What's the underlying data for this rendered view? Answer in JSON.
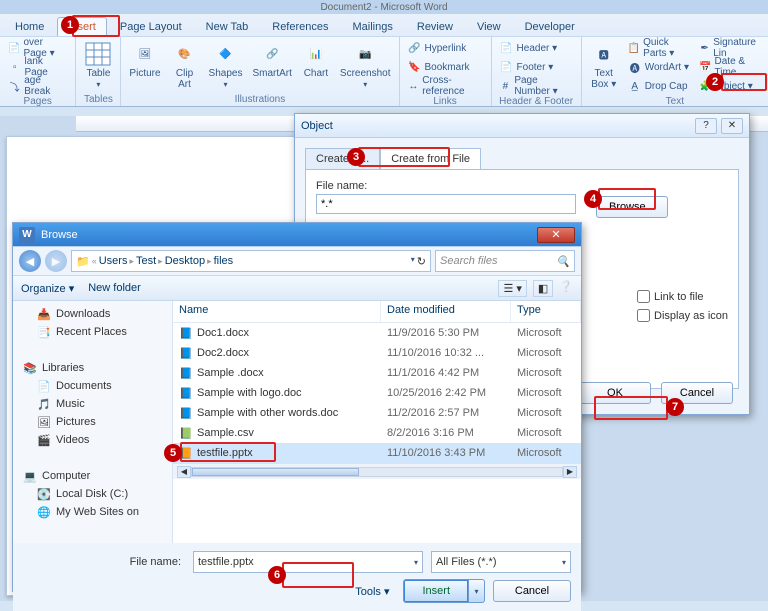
{
  "app": {
    "title": "Document2 - Microsoft Word"
  },
  "ribbon": {
    "tabs": [
      "Home",
      "Insert",
      "Page Layout",
      "New Tab",
      "References",
      "Mailings",
      "Review",
      "View",
      "Developer"
    ],
    "active": "Insert",
    "pages": {
      "cover": "over Page ▾",
      "blank": "lank Page",
      "break": "age Break",
      "group": "Pages"
    },
    "tables": {
      "table": "Table",
      "group": "Tables"
    },
    "illus": {
      "picture": "Picture",
      "clipart": "Clip\nArt",
      "shapes": "Shapes",
      "smartart": "SmartArt",
      "chart": "Chart",
      "screenshot": "Screenshot",
      "group": "Illustrations"
    },
    "links": {
      "hyperlink": "Hyperlink",
      "bookmark": "Bookmark",
      "crossref": "Cross-reference",
      "group": "Links"
    },
    "hf": {
      "header": "Header ▾",
      "footer": "Footer ▾",
      "pagenum": "Page Number ▾",
      "group": "Header & Footer"
    },
    "text": {
      "textbox": "Text\nBox ▾",
      "quickparts": "Quick Parts ▾",
      "wordart": "WordArt ▾",
      "dropcap": "Drop Cap",
      "object": "Object ▾",
      "sigline": "Signature Lin",
      "datetime": "Date & Time",
      "group": "Text"
    }
  },
  "objectDlg": {
    "title": "Object",
    "tab1": "Create N...",
    "tab2": "Create from File",
    "filenameLabel": "File name:",
    "filenameValue": "*.*",
    "browse": "Browse...",
    "link": "Link to file",
    "icon": "Display as icon",
    "ok": "OK",
    "cancel": "Cancel"
  },
  "browseDlg": {
    "appicon": "W",
    "title": "Browse",
    "path": [
      "Users",
      "Test",
      "Desktop",
      "files"
    ],
    "searchPlaceholder": "Search files",
    "organize": "Organize ▾",
    "newfolder": "New folder",
    "sidebar": [
      {
        "label": "Downloads",
        "ico": "📥",
        "indent": true
      },
      {
        "label": "Recent Places",
        "ico": "📑",
        "indent": true
      },
      {
        "label": "",
        "ico": "",
        "indent": false
      },
      {
        "label": "Libraries",
        "ico": "📚",
        "indent": false
      },
      {
        "label": "Documents",
        "ico": "📄",
        "indent": true
      },
      {
        "label": "Music",
        "ico": "🎵",
        "indent": true
      },
      {
        "label": "Pictures",
        "ico": "🖼",
        "indent": true
      },
      {
        "label": "Videos",
        "ico": "🎬",
        "indent": true
      },
      {
        "label": "",
        "ico": "",
        "indent": false
      },
      {
        "label": "Computer",
        "ico": "💻",
        "indent": false
      },
      {
        "label": "Local Disk (C:)",
        "ico": "💽",
        "indent": true
      },
      {
        "label": "My Web Sites on",
        "ico": "🌐",
        "indent": true
      }
    ],
    "columns": {
      "name": "Name",
      "date": "Date modified",
      "type": "Type"
    },
    "files": [
      {
        "ico": "📘",
        "name": "Doc1.docx",
        "date": "11/9/2016 5:30 PM",
        "type": "Microsoft"
      },
      {
        "ico": "📘",
        "name": "Doc2.docx",
        "date": "11/10/2016 10:32 ...",
        "type": "Microsoft"
      },
      {
        "ico": "📘",
        "name": "Sample .docx",
        "date": "11/1/2016 4:42 PM",
        "type": "Microsoft"
      },
      {
        "ico": "📘",
        "name": "Sample with logo.doc",
        "date": "10/25/2016 2:42 PM",
        "type": "Microsoft"
      },
      {
        "ico": "📘",
        "name": "Sample with other words.doc",
        "date": "11/2/2016 2:57 PM",
        "type": "Microsoft"
      },
      {
        "ico": "📗",
        "name": "Sample.csv",
        "date": "8/2/2016 3:16 PM",
        "type": "Microsoft"
      },
      {
        "ico": "📙",
        "name": "testfile.pptx",
        "date": "11/10/2016 3:43 PM",
        "type": "Microsoft",
        "selected": true
      }
    ],
    "filenameLabel": "File name:",
    "filenameValue": "testfile.pptx",
    "filter": "All Files (*.*)",
    "tools": "Tools ▾",
    "open": "Insert",
    "cancel": "Cancel"
  },
  "annotations": {
    "1": "1",
    "2": "2",
    "3": "3",
    "4": "4",
    "5": "5",
    "6": "6",
    "7": "7"
  }
}
